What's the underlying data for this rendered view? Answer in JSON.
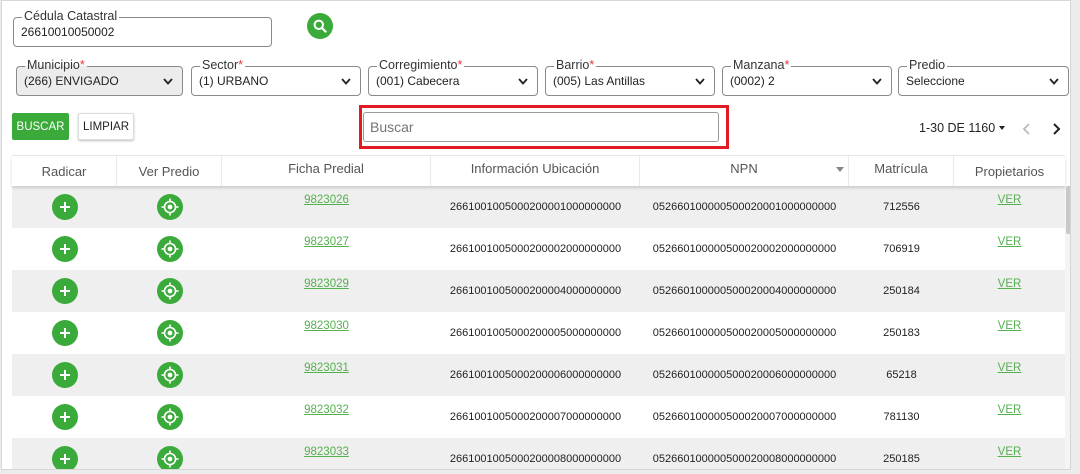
{
  "cedula": {
    "label": "Cédula Catastral",
    "value": "26610010050002"
  },
  "filters": {
    "municipio": {
      "label": "Municipio",
      "required": "*",
      "value": "(266) ENVIGADO"
    },
    "sector": {
      "label": "Sector",
      "required": "*",
      "value": "(1) URBANO"
    },
    "corregimiento": {
      "label": "Corregimiento",
      "required": "*",
      "value": "(001) Cabecera"
    },
    "barrio": {
      "label": "Barrio",
      "required": "*",
      "value": "(005) Las Antillas"
    },
    "manzana": {
      "label": "Manzana",
      "required": "*",
      "value": "(0002) 2"
    },
    "predio": {
      "label": "Predio",
      "value": "Seleccione"
    }
  },
  "toolbar": {
    "buscar_label": "BUSCAR",
    "limpiar_label": "LIMPIAR",
    "search_placeholder": "Buscar",
    "pager_text": "1-30 DE 1160"
  },
  "table": {
    "headers": [
      "Radicar",
      "Ver Predio",
      "Ficha Predial",
      "Información Ubicación",
      "NPN",
      "Matrícula",
      "Propietarios"
    ],
    "rows": [
      {
        "ficha": "9823026",
        "ubicacion": "2661001005000200001000000000",
        "npn": "052660100000500020001000000000",
        "matricula": "712556",
        "propietarios": "VER"
      },
      {
        "ficha": "9823027",
        "ubicacion": "2661001005000200002000000000",
        "npn": "052660100000500020002000000000",
        "matricula": "706919",
        "propietarios": "VER"
      },
      {
        "ficha": "9823029",
        "ubicacion": "2661001005000200004000000000",
        "npn": "052660100000500020004000000000",
        "matricula": "250184",
        "propietarios": "VER"
      },
      {
        "ficha": "9823030",
        "ubicacion": "2661001005000200005000000000",
        "npn": "052660100000500020005000000000",
        "matricula": "250183",
        "propietarios": "VER"
      },
      {
        "ficha": "9823031",
        "ubicacion": "2661001005000200006000000000",
        "npn": "052660100000500020006000000000",
        "matricula": "65218",
        "propietarios": "VER"
      },
      {
        "ficha": "9823032",
        "ubicacion": "2661001005000200007000000000",
        "npn": "052660100000500020007000000000",
        "matricula": "781130",
        "propietarios": "VER"
      },
      {
        "ficha": "9823033",
        "ubicacion": "2661001005000200008000000000",
        "npn": "052660100000500020008000000000",
        "matricula": "250185",
        "propietarios": "VER"
      }
    ]
  },
  "colors": {
    "accent": "#3aaa3a",
    "link": "#55b050",
    "highlight": "#e01b24",
    "required": "#e53935"
  },
  "icons": {
    "search": "magnifier-icon",
    "add": "plus-circle-icon",
    "locate": "crosshair-icon",
    "prev": "chevron-left-icon",
    "next": "chevron-right-icon",
    "dropdown": "chevron-down-icon"
  }
}
